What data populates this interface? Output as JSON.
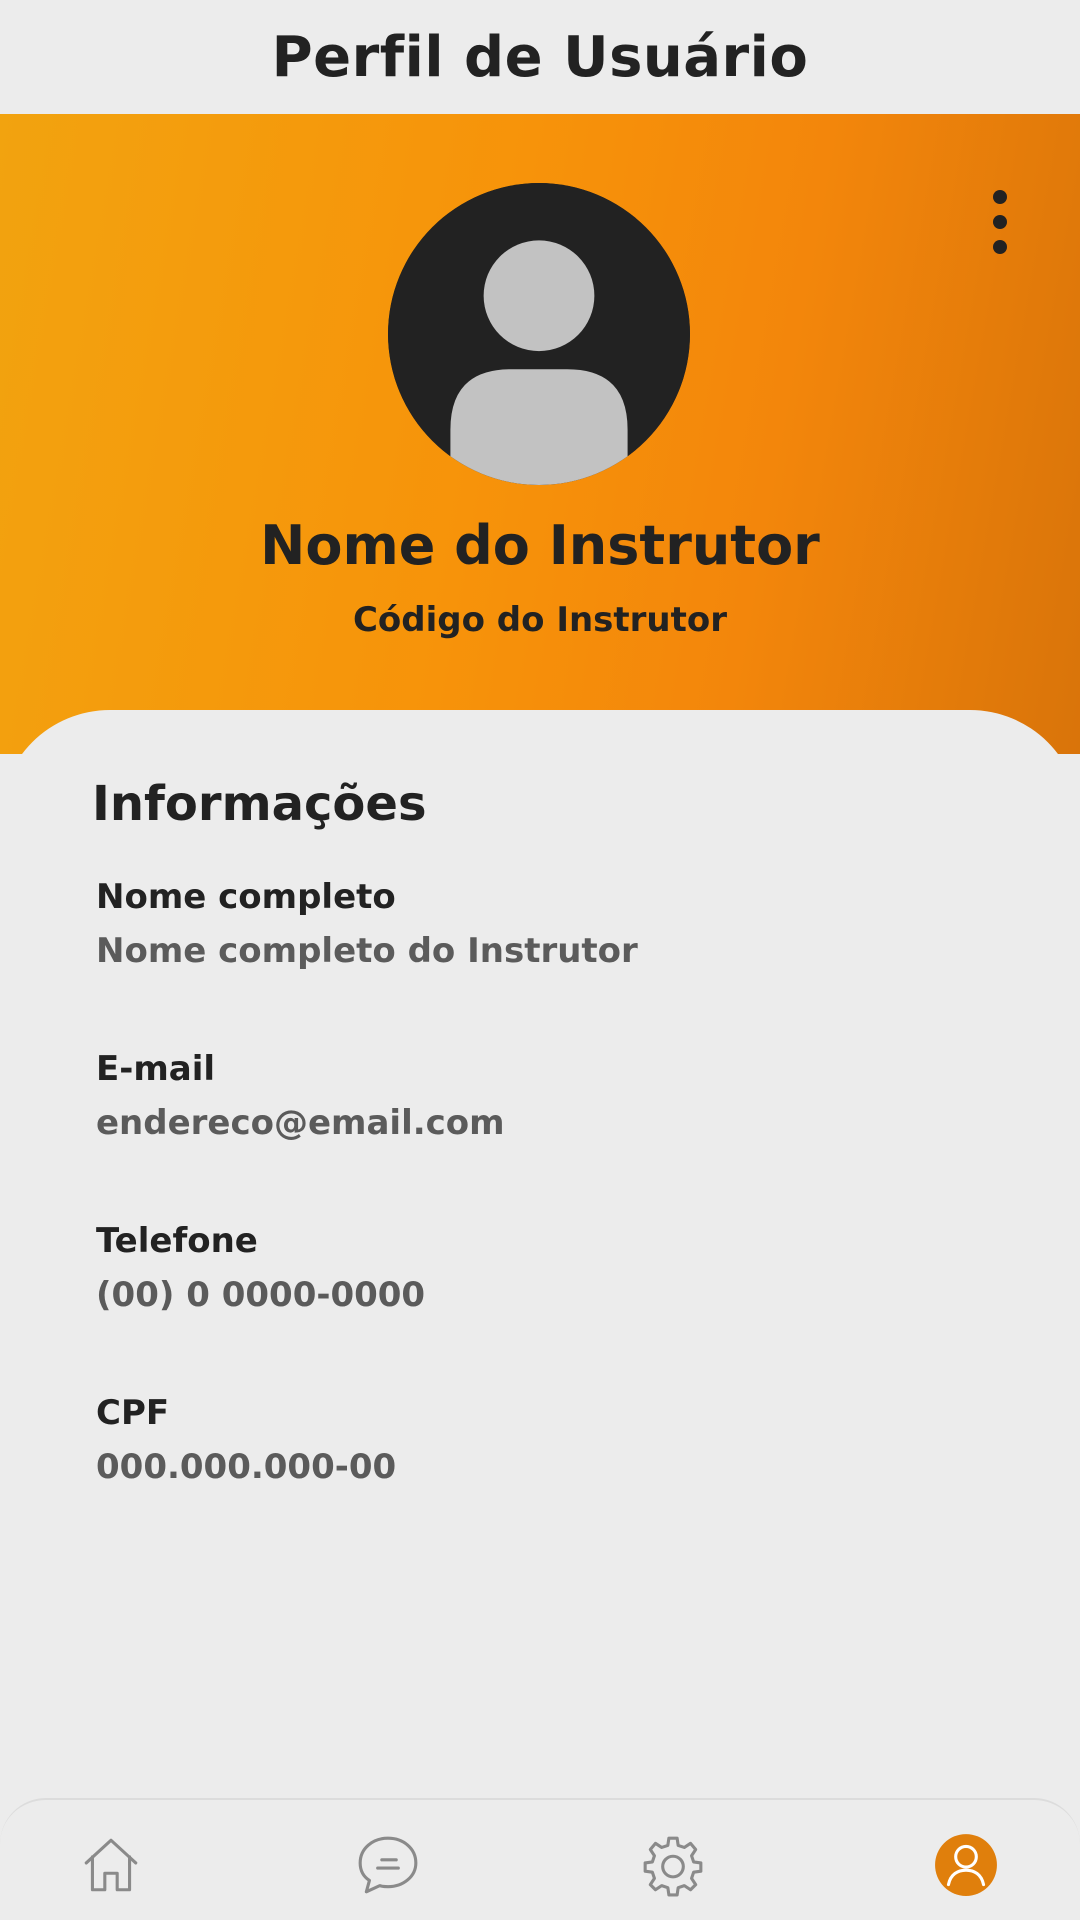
{
  "header": {
    "title": "Perfil de Usuário"
  },
  "profile": {
    "name": "Nome do Instrutor",
    "code": "Código do Instrutor",
    "avatar_icon": "user-placeholder-icon",
    "menu_icon": "more-vertical-icon"
  },
  "info": {
    "title": "Informações",
    "fields": [
      {
        "label": "Nome completo",
        "value": "Nome completo do Instrutor"
      },
      {
        "label": "E-mail",
        "value": "endereco@email.com"
      },
      {
        "label": "Telefone",
        "value": "(00) 0 0000-0000"
      },
      {
        "label": "CPF",
        "value": "000.000.000-00"
      }
    ]
  },
  "nav": {
    "items": [
      {
        "icon": "home-icon",
        "active": false
      },
      {
        "icon": "chat-icon",
        "active": false
      },
      {
        "icon": "gear-icon",
        "active": false
      },
      {
        "icon": "profile-icon",
        "active": true
      }
    ]
  },
  "colors": {
    "accent": "#f7930a",
    "accent_dark": "#d9740a",
    "text": "#222222",
    "muted": "#5b5b5b",
    "background": "#ececec",
    "icon_inactive": "#8a8a8a",
    "nav_active": "#e07f0c"
  }
}
